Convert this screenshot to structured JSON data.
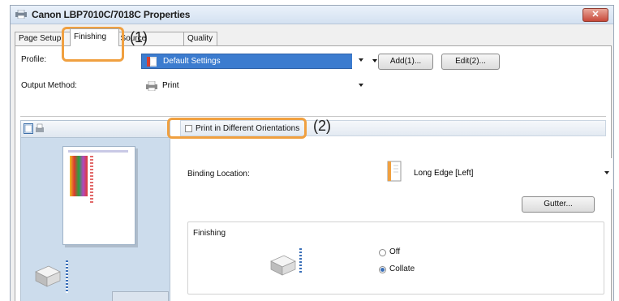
{
  "window": {
    "title": "Canon LBP7010C/7018C Properties",
    "close_glyph": "✕"
  },
  "tabs": [
    {
      "label": "Page Setup"
    },
    {
      "label": "Finishing"
    },
    {
      "label": "Paper Source"
    },
    {
      "label": "Quality"
    }
  ],
  "profile": {
    "label": "Profile:",
    "value": "Default Settings",
    "add_button": "Add(1)...",
    "edit_button": "Edit(2)..."
  },
  "output_method": {
    "label": "Output Method:",
    "value": "Print"
  },
  "print_orientations": {
    "label": "Print in Different Orientations",
    "checked": false
  },
  "binding": {
    "label": "Binding Location:",
    "value": "Long Edge [Left]",
    "gutter_button": "Gutter..."
  },
  "finishing": {
    "group_label": "Finishing",
    "options": [
      {
        "label": "Off",
        "selected": false
      },
      {
        "label": "Collate",
        "selected": true
      }
    ]
  },
  "callouts": [
    {
      "label": "(1)"
    },
    {
      "label": "(2)"
    }
  ],
  "colors": {
    "accent": "#f0a040",
    "selection": "#3a6fb8",
    "preview_bg": "#ccdcec"
  },
  "icons": {
    "app": "printer-icon",
    "page_view": "page-view-icon",
    "printer_view": "printer-view-icon",
    "binding": "binding-long-edge-icon",
    "finishing": "stacked-paper-icon"
  }
}
